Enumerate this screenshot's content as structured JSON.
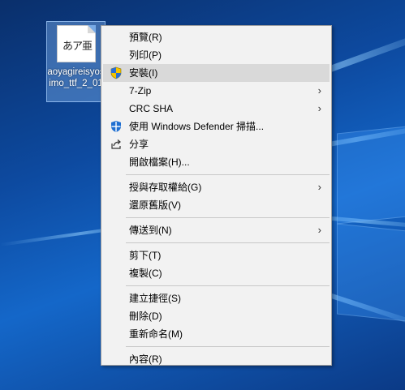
{
  "desktop": {
    "file_icon_glyph": "あア亜",
    "file_label": "aoyagireisyosimo_ttf_2_01"
  },
  "menu": {
    "items": [
      {
        "label": "預覽(R)",
        "icon": "none",
        "submenu": false
      },
      {
        "label": "列印(P)",
        "icon": "none",
        "submenu": false
      },
      {
        "label": "安裝(I)",
        "icon": "uac-shield-icon",
        "submenu": false,
        "highlighted": true
      },
      {
        "label": "7-Zip",
        "icon": "none",
        "submenu": true
      },
      {
        "label": "CRC SHA",
        "icon": "none",
        "submenu": true
      },
      {
        "label": "使用 Windows Defender 掃描...",
        "icon": "windows-defender-icon",
        "submenu": false
      },
      {
        "label": "分享",
        "icon": "share-icon",
        "submenu": false
      },
      {
        "label": "開啟檔案(H)...",
        "icon": "none",
        "submenu": false
      },
      {
        "label": "授與存取權給(G)",
        "icon": "none",
        "submenu": true
      },
      {
        "label": "還原舊版(V)",
        "icon": "none",
        "submenu": false
      },
      {
        "label": "傳送到(N)",
        "icon": "none",
        "submenu": true
      },
      {
        "label": "剪下(T)",
        "icon": "none",
        "submenu": false
      },
      {
        "label": "複製(C)",
        "icon": "none",
        "submenu": false
      },
      {
        "label": "建立捷徑(S)",
        "icon": "none",
        "submenu": false
      },
      {
        "label": "刪除(D)",
        "icon": "none",
        "submenu": false
      },
      {
        "label": "重新命名(M)",
        "icon": "none",
        "submenu": false
      },
      {
        "label": "內容(R)",
        "icon": "none",
        "submenu": false
      }
    ]
  },
  "colors": {
    "menu_bg": "#f2f2f2",
    "highlight": "#d9d9d9",
    "desktop_blue": "#0d4aa0"
  }
}
